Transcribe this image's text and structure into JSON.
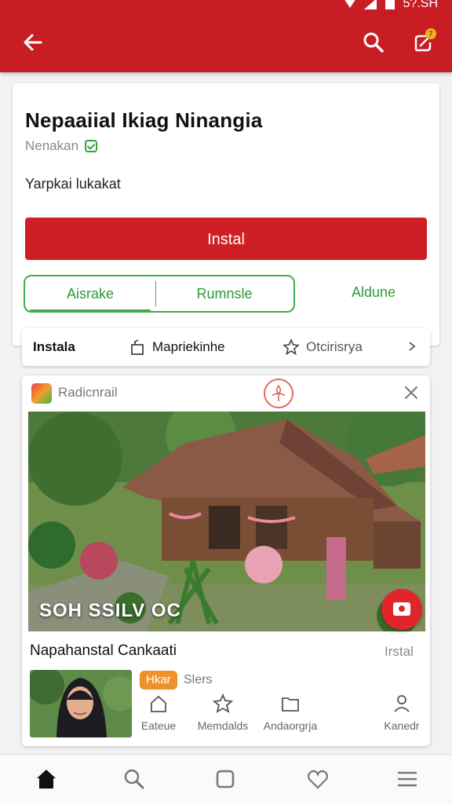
{
  "status": {
    "time": "5?.SH"
  },
  "app": {
    "title": "Nepaaiial Ikiag Ninangia",
    "developer": "Nenakan",
    "subtitle": "Yarpkai lukakat",
    "install_label": "Instal",
    "tabs": [
      {
        "label": "Aisrake"
      },
      {
        "label": "Rumnsle"
      },
      {
        "label": "Aldune"
      }
    ]
  },
  "notifications": {
    "badge": "7"
  },
  "quickbar": {
    "install_label": "Instala",
    "item2": "Mapriekinhe",
    "item3": "Otcirisrya"
  },
  "feed": {
    "brand": "Radicnrail",
    "photo_caption": "SOH SSILV OC",
    "listing_title": "Napahanstal Cankaati",
    "listing_action": "Irstal",
    "chip_label": "Hkar",
    "chip_after": "Slers",
    "actions": [
      {
        "label": "Eateue",
        "icon": "home-outline-icon"
      },
      {
        "label": "Memdalds",
        "icon": "star-outline-icon"
      },
      {
        "label": "Andaorgrja",
        "icon": "folder-icon"
      },
      {
        "label": "Kanedr",
        "icon": "person-icon"
      }
    ]
  },
  "bottom_nav": [
    {
      "icon": "home-icon"
    },
    {
      "icon": "search-icon"
    },
    {
      "icon": "square-icon"
    },
    {
      "icon": "heart-icon"
    },
    {
      "icon": "menu-icon"
    }
  ],
  "colors": {
    "primary": "#c91d24",
    "accent_green": "#3fae47",
    "chip": "#f0902a"
  }
}
